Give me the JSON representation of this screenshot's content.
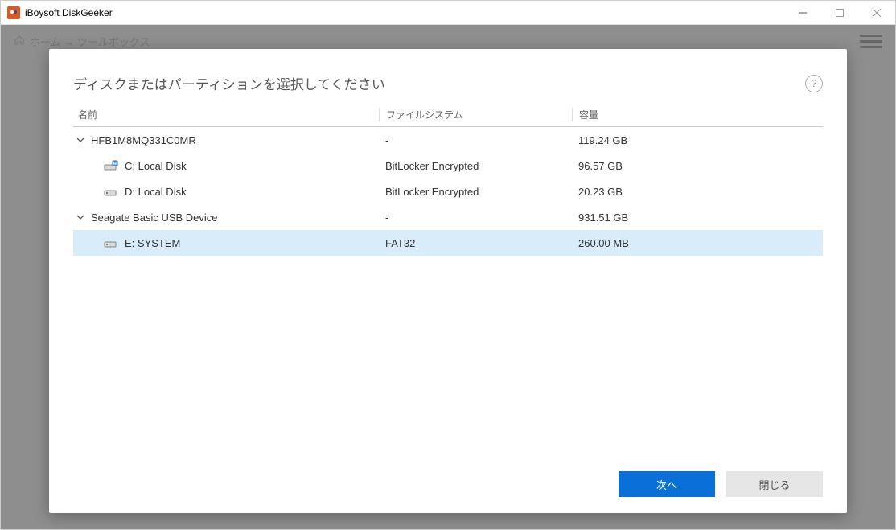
{
  "window": {
    "title": "iBoysoft DiskGeeker"
  },
  "background": {
    "breadcrumb": "ホーム → ツールボックス"
  },
  "modal": {
    "title": "ディスクまたはパーティションを選択してください",
    "columns": {
      "name": "名前",
      "filesystem": "ファイルシステム",
      "size": "容量"
    },
    "disks": [
      {
        "name": "HFB1M8MQ331C0MR",
        "filesystem": "-",
        "size": "119.24 GB",
        "partitions": [
          {
            "name": "C: Local Disk",
            "filesystem": "BitLocker Encrypted",
            "size": "96.57 GB",
            "icon": "drive-win"
          },
          {
            "name": "D: Local Disk",
            "filesystem": "BitLocker Encrypted",
            "size": "20.23 GB",
            "icon": "drive"
          }
        ]
      },
      {
        "name": "Seagate Basic USB Device",
        "filesystem": "-",
        "size": "931.51 GB",
        "partitions": [
          {
            "name": "E: SYSTEM",
            "filesystem": "FAT32",
            "size": "260.00 MB",
            "icon": "drive",
            "selected": true
          }
        ]
      }
    ],
    "buttons": {
      "next": "次へ",
      "close": "閉じる"
    }
  }
}
